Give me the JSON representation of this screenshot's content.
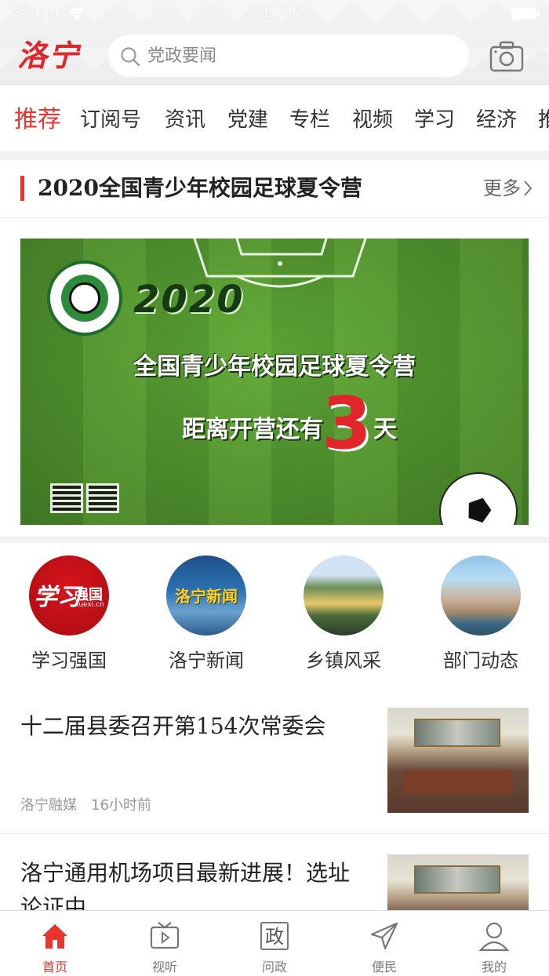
{
  "status_bar": {
    "carrier": "Carrier",
    "time": "2:32 PM"
  },
  "header": {
    "logo": "洛宁",
    "search": {
      "placeholder": "党政要闻"
    }
  },
  "categories": [
    {
      "label": "推荐",
      "active": true
    },
    {
      "label": "订阅号"
    },
    {
      "label": "资讯"
    },
    {
      "label": "党建"
    },
    {
      "label": "专栏"
    },
    {
      "label": "视频"
    },
    {
      "label": "学习"
    },
    {
      "label": "经济"
    },
    {
      "label": "推"
    }
  ],
  "section": {
    "title": "2020全国青少年校园足球夏令营",
    "more": "更多"
  },
  "banner": {
    "year": "2020",
    "title": "全国青少年校园足球夏令营",
    "countdown_prefix": "距离开营还有",
    "days": "3",
    "unit": "天"
  },
  "quick_links": [
    {
      "label": "学习强国",
      "icon": "xuexi-logo",
      "icon_text": "学习",
      "icon_sub": "强国",
      "icon_small": "xuexi.cn"
    },
    {
      "label": "洛宁新闻",
      "icon": "luoning-news-logo",
      "icon_text": "洛宁新闻"
    },
    {
      "label": "乡镇风采",
      "icon": "town-landscape-image"
    },
    {
      "label": "部门动态",
      "icon": "city-skyline-image"
    }
  ],
  "news": [
    {
      "title": "十二届县委召开第154次常委会",
      "source": "洛宁融媒",
      "time": "16小时前"
    },
    {
      "title": "洛宁通用机场项目最新进展！选址论证中……"
    }
  ],
  "tabbar": [
    {
      "label": "首页",
      "icon": "home-icon",
      "active": true
    },
    {
      "label": "视听",
      "icon": "tv-icon"
    },
    {
      "label": "问政",
      "icon": "zheng-icon",
      "icon_text": "政"
    },
    {
      "label": "便民",
      "icon": "send-icon"
    },
    {
      "label": "我的",
      "icon": "user-icon"
    }
  ],
  "colors": {
    "accent": "#e8352d",
    "logo": "#e0262b"
  }
}
